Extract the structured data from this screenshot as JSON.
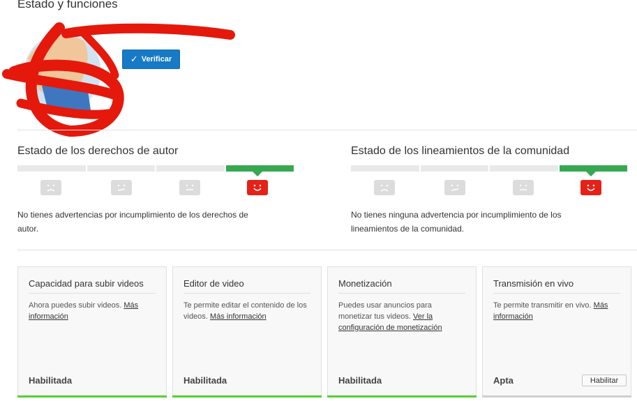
{
  "page": {
    "title": "Estado y funciones"
  },
  "account": {
    "verify_label": "Verificar"
  },
  "copyright": {
    "heading": "Estado de los derechos de autor",
    "strike_level": 0,
    "message": "No tienes advertencias por incumplimiento de los derechos de autor."
  },
  "community": {
    "heading": "Estado de los lineamientos de la comunidad",
    "strike_level": 0,
    "message": "No tienes ninguna advertencia por incumplimiento de los lineamientos de la comunidad."
  },
  "features": [
    {
      "title": "Capacidad para subir videos",
      "desc": "Ahora puedes subir videos. ",
      "link": "Más información",
      "status": "Habilitada"
    },
    {
      "title": "Editor de video",
      "desc": "Te permite editar el contenido de los videos. ",
      "link": "Más información",
      "status": "Habilitada"
    },
    {
      "title": "Monetización",
      "desc": "Puedes usar anuncios para monetizar tus videos. ",
      "link": "Ver la configuración de monetización",
      "status": "Habilitada"
    },
    {
      "title": "Transmisión en vivo",
      "desc": "Te permite transmitir en vivo. ",
      "link": "Más información",
      "status": "Apta",
      "action": "Habilitar"
    }
  ],
  "colors": {
    "accent_blue": "#167ac6",
    "strike_ok": "#36a852",
    "strike_icon_active": "#e62117",
    "enabled_bar": "#55d131"
  }
}
